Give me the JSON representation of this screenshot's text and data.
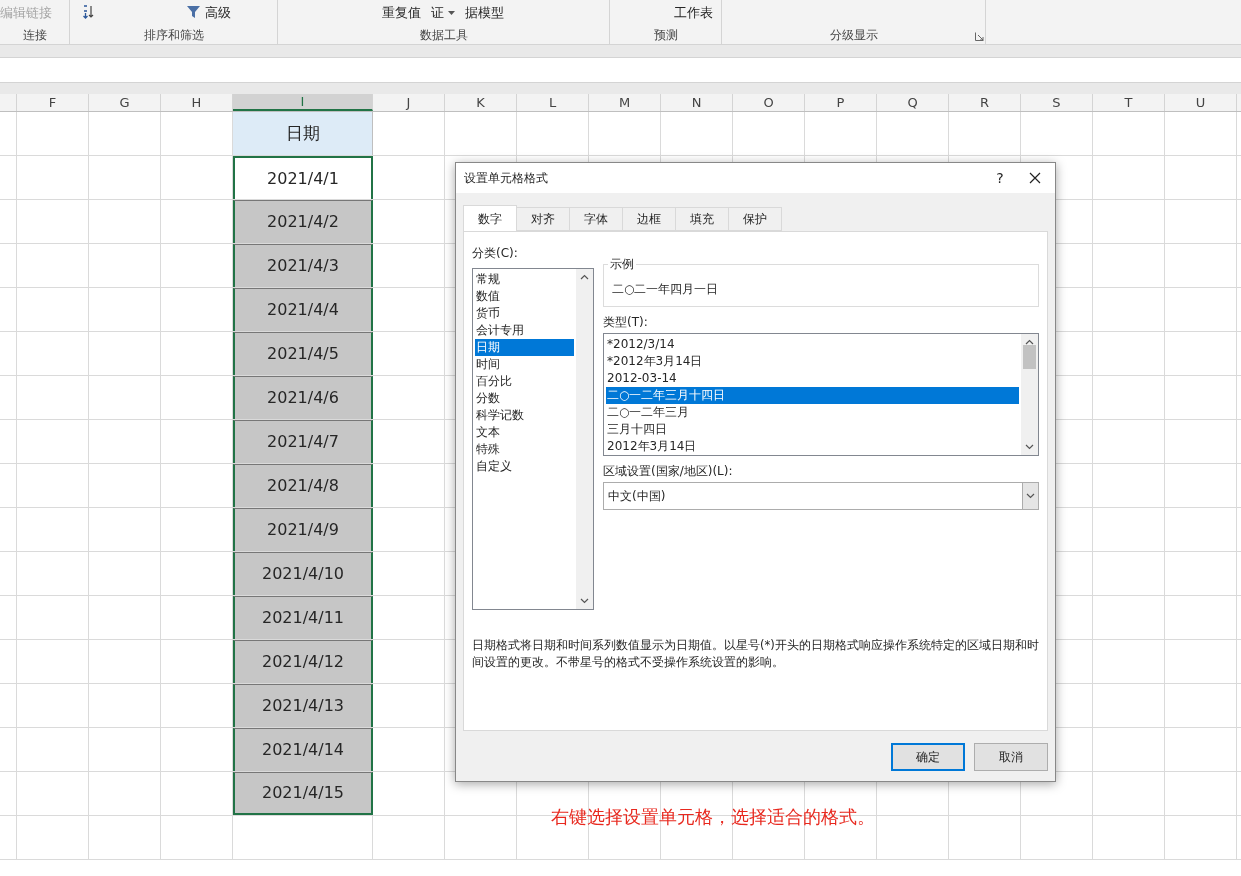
{
  "ribbon": {
    "groups": [
      {
        "label": "连接",
        "items": [
          {
            "label": "编辑链接",
            "disabled": true,
            "kind": "text"
          }
        ]
      },
      {
        "label": "排序和筛选",
        "items": [
          {
            "kind": "sort"
          },
          {
            "label": "高级",
            "disabled": false,
            "kind": "filter"
          }
        ]
      },
      {
        "label": "数据工具",
        "items": [
          {
            "label": "重复值",
            "disabled": false,
            "kind": "text"
          },
          {
            "label": "证",
            "disabled": false,
            "kind": "dropdown"
          },
          {
            "label": "据模型",
            "disabled": false,
            "kind": "text"
          }
        ]
      },
      {
        "label": "预测",
        "items": [
          {
            "label": "工作表",
            "disabled": false,
            "kind": "text"
          }
        ]
      },
      {
        "label": "分级显示",
        "launcher": true
      }
    ]
  },
  "columns": [
    {
      "label": "F",
      "selected": false
    },
    {
      "label": "G",
      "selected": false
    },
    {
      "label": "H",
      "selected": false
    },
    {
      "label": "I",
      "selected": true
    },
    {
      "label": "J",
      "selected": false
    },
    {
      "label": "K",
      "selected": false
    },
    {
      "label": "L",
      "selected": false
    },
    {
      "label": "M",
      "selected": false
    },
    {
      "label": "N",
      "selected": false
    },
    {
      "label": "O",
      "selected": false
    },
    {
      "label": "P",
      "selected": false
    },
    {
      "label": "Q",
      "selected": false
    },
    {
      "label": "R",
      "selected": false
    },
    {
      "label": "S",
      "selected": false
    },
    {
      "label": "T",
      "selected": false
    },
    {
      "label": "U",
      "selected": false
    }
  ],
  "header_cell": "日期",
  "cells": [
    {
      "value": "2021/4/1",
      "selected": false
    },
    {
      "value": "2021/4/2",
      "selected": true
    },
    {
      "value": "2021/4/3",
      "selected": true
    },
    {
      "value": "2021/4/4",
      "selected": true
    },
    {
      "value": "2021/4/5",
      "selected": true
    },
    {
      "value": "2021/4/6",
      "selected": true
    },
    {
      "value": "2021/4/7",
      "selected": true
    },
    {
      "value": "2021/4/8",
      "selected": true
    },
    {
      "value": "2021/4/9",
      "selected": true
    },
    {
      "value": "2021/4/10",
      "selected": true
    },
    {
      "value": "2021/4/11",
      "selected": true
    },
    {
      "value": "2021/4/12",
      "selected": true
    },
    {
      "value": "2021/4/13",
      "selected": true
    },
    {
      "value": "2021/4/14",
      "selected": true
    },
    {
      "value": "2021/4/15",
      "selected": true
    }
  ],
  "dialog": {
    "title": "设置单元格格式",
    "help": "?",
    "tabs": [
      {
        "label": "数字",
        "selected": true
      },
      {
        "label": "对齐",
        "selected": false
      },
      {
        "label": "字体",
        "selected": false
      },
      {
        "label": "边框",
        "selected": false
      },
      {
        "label": "填充",
        "selected": false
      },
      {
        "label": "保护",
        "selected": false
      }
    ],
    "category_label": "分类(C):",
    "categories": [
      {
        "label": "常规",
        "selected": false
      },
      {
        "label": "数值",
        "selected": false
      },
      {
        "label": "货币",
        "selected": false
      },
      {
        "label": "会计专用",
        "selected": false
      },
      {
        "label": "日期",
        "selected": true
      },
      {
        "label": "时间",
        "selected": false
      },
      {
        "label": "百分比",
        "selected": false
      },
      {
        "label": "分数",
        "selected": false
      },
      {
        "label": "科学记数",
        "selected": false
      },
      {
        "label": "文本",
        "selected": false
      },
      {
        "label": "特殊",
        "selected": false
      },
      {
        "label": "自定义",
        "selected": false
      }
    ],
    "sample_label": "示例",
    "sample_value": "二○二一年四月一日",
    "type_label": "类型(T):",
    "types": [
      {
        "label": "*2012/3/14",
        "selected": false
      },
      {
        "label": "*2012年3月14日",
        "selected": false
      },
      {
        "label": "2012-03-14",
        "selected": false
      },
      {
        "label": "二○一二年三月十四日",
        "selected": true
      },
      {
        "label": "二○一二年三月",
        "selected": false
      },
      {
        "label": "三月十四日",
        "selected": false
      },
      {
        "label": "2012年3月14日",
        "selected": false
      }
    ],
    "locale_label": "区域设置(国家/地区)(L):",
    "locale_value": "中文(中国)",
    "description": "日期格式将日期和时间系列数值显示为日期值。以星号(*)开头的日期格式响应操作系统特定的区域日期和时间设置的更改。不带星号的格式不受操作系统设置的影响。",
    "buttons": [
      {
        "label": "确定",
        "default": true
      },
      {
        "label": "取消",
        "default": false
      }
    ]
  },
  "caption": "右键选择设置单元格，选择适合的格式。"
}
